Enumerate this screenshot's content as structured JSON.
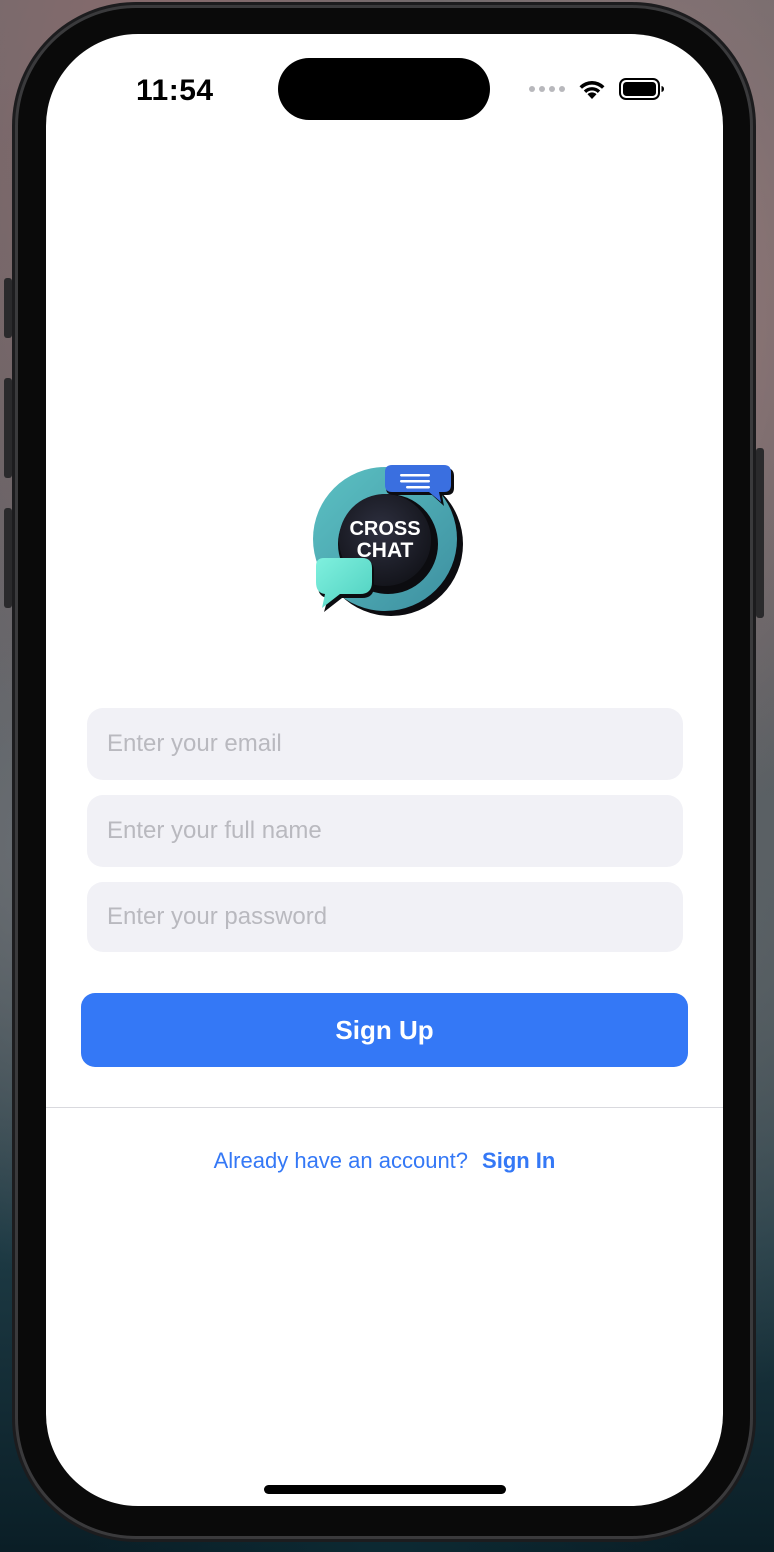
{
  "status_bar": {
    "time": "11:54"
  },
  "logo": {
    "line1": "CROSS",
    "line2": "CHAT"
  },
  "form": {
    "email_placeholder": "Enter your email",
    "name_placeholder": "Enter your full name",
    "password_placeholder": "Enter your password",
    "submit_label": "Sign Up"
  },
  "footer": {
    "prompt": "Already have an account?",
    "signin_label": "Sign In"
  },
  "colors": {
    "accent": "#3478f6",
    "field_background": "#f1f1f6",
    "logo_teal": "#4fb3b8",
    "logo_mint": "#6fe3d2",
    "logo_dark": "#1c1d26"
  },
  "icons": [
    "cellular-signal-icon",
    "wifi-icon",
    "battery-icon",
    "app-logo"
  ]
}
